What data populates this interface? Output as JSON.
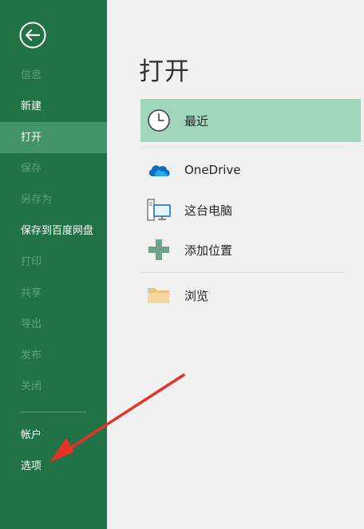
{
  "sidebar": {
    "items": [
      {
        "label": "信息",
        "enabled": false
      },
      {
        "label": "新建",
        "enabled": true
      },
      {
        "label": "打开",
        "enabled": true,
        "selected": true
      },
      {
        "label": "保存",
        "enabled": false
      },
      {
        "label": "另存为",
        "enabled": false
      },
      {
        "label": "保存到百度网盘",
        "enabled": true
      },
      {
        "label": "打印",
        "enabled": false
      },
      {
        "label": "共享",
        "enabled": false
      },
      {
        "label": "导出",
        "enabled": false
      },
      {
        "label": "发布",
        "enabled": false
      },
      {
        "label": "关闭",
        "enabled": false
      }
    ],
    "bottom_items": [
      {
        "label": "帐户"
      },
      {
        "label": "选项"
      }
    ]
  },
  "main": {
    "title": "打开",
    "locations": [
      {
        "label": "最近",
        "icon": "clock-icon",
        "selected": true
      },
      {
        "label": "OneDrive",
        "icon": "cloud-icon"
      },
      {
        "label": "这台电脑",
        "icon": "computer-icon"
      },
      {
        "label": "添加位置",
        "icon": "plus-icon"
      },
      {
        "label": "浏览",
        "icon": "folder-icon"
      }
    ]
  },
  "colors": {
    "sidebar_bg": "#217346",
    "sidebar_selected": "#439467",
    "location_selected": "#a0d6bc",
    "annotation_arrow": "#e8312a"
  }
}
